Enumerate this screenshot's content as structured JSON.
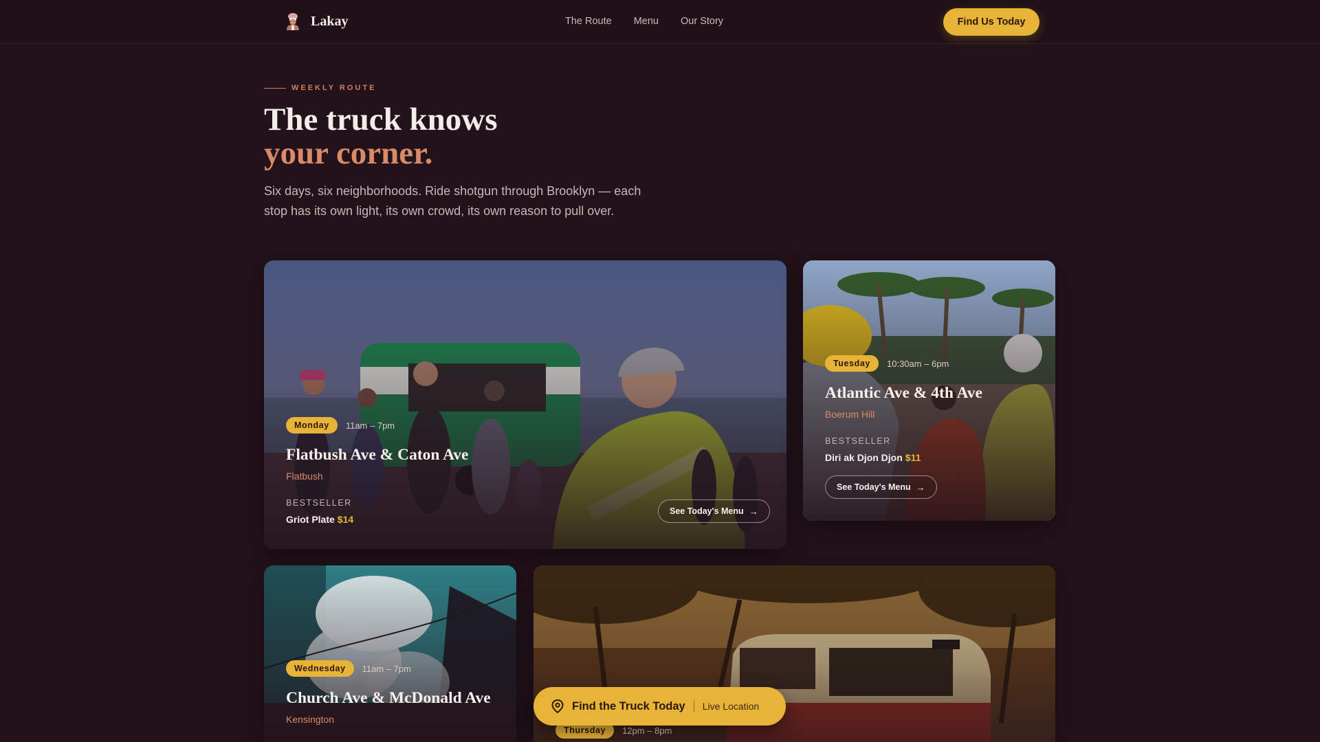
{
  "header": {
    "brand": "Lakay",
    "logo_icon": "chef-icon",
    "nav": [
      "The Route",
      "Menu",
      "Our Story"
    ],
    "cta_label": "Find Us Today"
  },
  "intro": {
    "eyebrow": "WEEKLY ROUTE",
    "title_line1": "The truck knows",
    "title_line2": "your corner.",
    "subtitle": "Six days, six neighborhoods. Ride shotgun through Brooklyn — each stop has its own light, its own crowd, its own reason to pull over."
  },
  "stops": [
    {
      "day": "Monday",
      "hours": "11am – 7pm",
      "title": "Flatbush Ave & Caton Ave",
      "neighborhood": "Flatbush",
      "bestseller_label": "BESTSELLER",
      "bestseller_item": "Griot Plate",
      "bestseller_price": "$14",
      "menu_label": "See Today's Menu"
    },
    {
      "day": "Tuesday",
      "hours": "10:30am – 6pm",
      "title": "Atlantic Ave & 4th Ave",
      "neighborhood": "Boerum Hill",
      "bestseller_label": "BESTSELLER",
      "bestseller_item": "Diri ak Djon Djon",
      "bestseller_price": "$11",
      "menu_label": "See Today's Menu"
    },
    {
      "day": "Wednesday",
      "hours": "11am – 7pm",
      "title": "Church Ave & McDonald Ave",
      "neighborhood": "Kensington"
    },
    {
      "day": "Thursday",
      "hours": "12pm – 8pm"
    }
  ],
  "locator": {
    "title": "Find the Truck Today",
    "subtitle": "Live Location",
    "icon": "map-pin-icon"
  },
  "colors": {
    "background": "#221219",
    "accent": "#e8b438",
    "terracotta": "#d98a69"
  }
}
